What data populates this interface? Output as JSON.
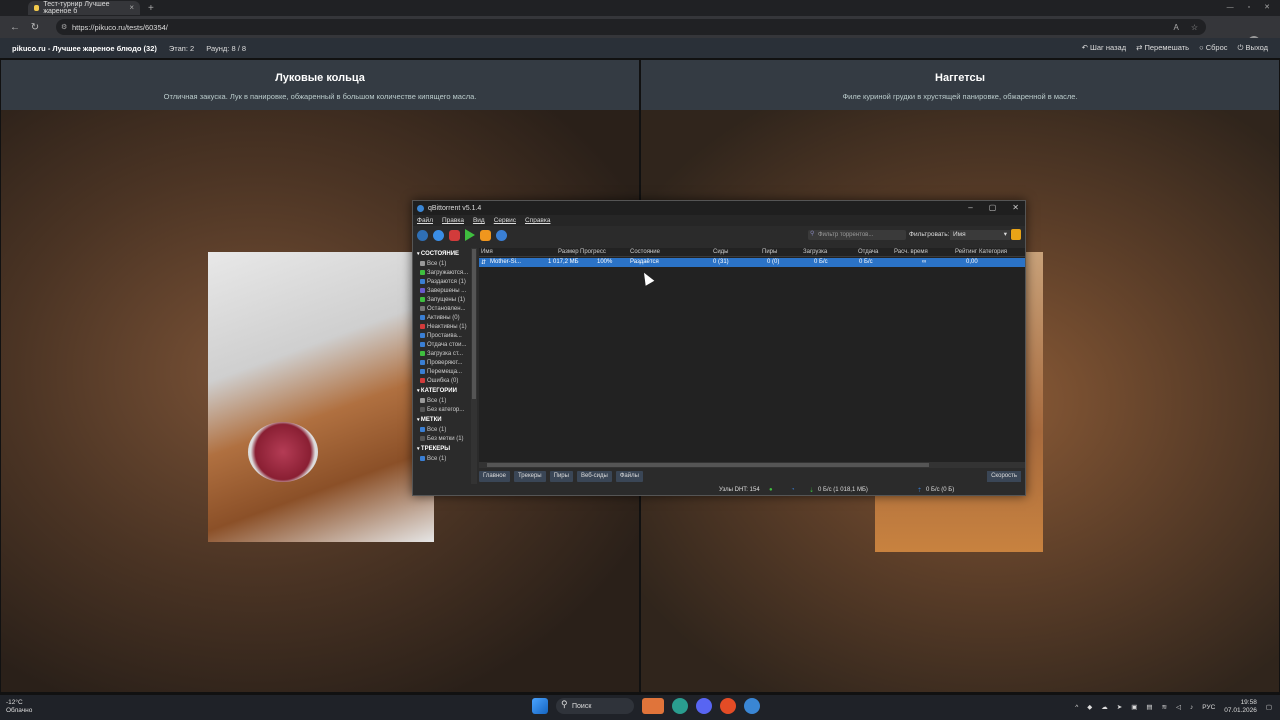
{
  "browser": {
    "tab_title": "Тест-турнир Лучшее жареное б",
    "url": "https://pikuco.ru/tests/60354/"
  },
  "site": {
    "title": "pikuco.ru - Лучшее жареное блюдо (32)",
    "stage": "Этап: 2",
    "round": "Раунд: 8 / 8",
    "actions": [
      "Шаг назад",
      "Перемешать",
      "Сброс",
      "Выход"
    ]
  },
  "options": [
    {
      "title": "Луковые кольца",
      "desc": "Отличная закуска. Лук в панировке, обжаренный в большом количестве кипящего масла."
    },
    {
      "title": "Наггетсы",
      "desc": "Филе куриной грудки в хрустящей панировке, обжаренной в масле."
    }
  ],
  "qbittorrent": {
    "title": "qBittorrent v5.1.4",
    "menu": [
      "Файл",
      "Правка",
      "Вид",
      "Сервис",
      "Справка"
    ],
    "filter_placeholder": "Фильтр торрентов...",
    "filter_label": "Фильтровать:",
    "filter_value": "Имя",
    "sidebar": {
      "status_header": "СОСТОЯНИЕ",
      "status_items": [
        "Все (1)",
        "Загружаются...",
        "Раздаются (1)",
        "Завершены ...",
        "Запущены (1)",
        "Остановлен...",
        "Активны (0)",
        "Неактивны (1)",
        "Простаива...",
        "Отдача стои...",
        "Загрузка ст...",
        "Проверяют...",
        "Перемеща...",
        "Ошибка (0)"
      ],
      "categories_header": "КАТЕГОРИИ",
      "category_items": [
        "Все (1)",
        "Без категор..."
      ],
      "tags_header": "МЕТКИ",
      "tag_items": [
        "Все (1)",
        "Без метки (1)"
      ],
      "trackers_header": "ТРЕКЕРЫ",
      "tracker_items": [
        "Все (1)"
      ]
    },
    "columns": [
      "Имя",
      "Размер",
      "Прогресс",
      "Состояние",
      "Сиды",
      "Пиры",
      "Загрузка",
      "Отдача",
      "Расч. время",
      "Рейтинг",
      "Категория"
    ],
    "row": {
      "name": "Mother-Si...",
      "size": "1 017,2 МБ",
      "progress": "100%",
      "state": "Раздаётся",
      "seeds": "0 (31)",
      "peers": "0 (0)",
      "down": "0 Б/с",
      "up": "0 Б/с",
      "eta": "∞",
      "ratio": "0,00",
      "category": ""
    },
    "bottom_tabs": [
      "Главное",
      "Трекеры",
      "Пиры",
      "Веб-сиды",
      "Файлы"
    ],
    "speed_button": "Скорость",
    "status": {
      "dht": "Узлы DHT: 154",
      "down": "0 Б/с (1 018,1 МБ)",
      "up": "0 Б/с (0 Б)"
    }
  },
  "taskbar": {
    "temp": "-12°C",
    "weather": "Облачно",
    "search": "Поиск",
    "lang": "РУС",
    "time": "19:58",
    "date": "07.01.2026"
  }
}
